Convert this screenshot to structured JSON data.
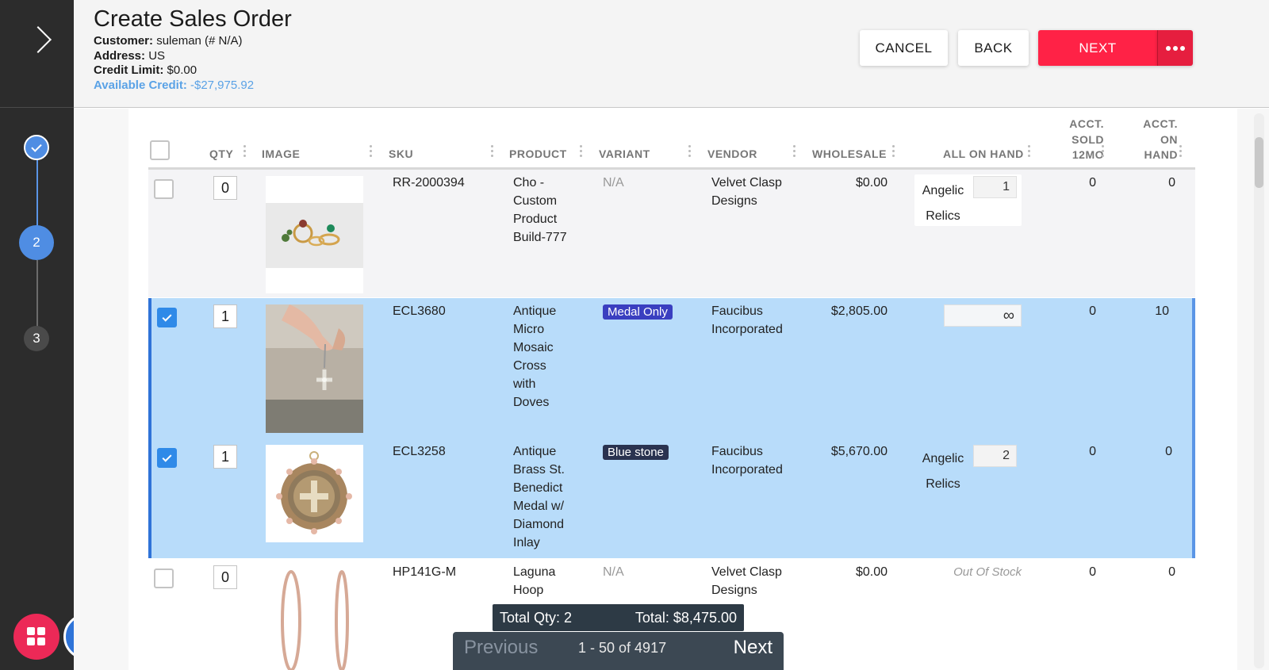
{
  "header": {
    "title": "Create Sales Order",
    "customer_label": "Customer:",
    "customer_value": "suleman (# N/A)",
    "address_label": "Address:",
    "address_value": "US",
    "credit_limit_label": "Credit Limit:",
    "credit_limit_value": "$0.00",
    "available_credit_label": "Available Credit:",
    "available_credit_value": "-$27,975.92",
    "cancel_label": "CANCEL",
    "back_label": "BACK",
    "next_label": "NEXT"
  },
  "steps": {
    "step2": "2",
    "step3": "3"
  },
  "table": {
    "columns": {
      "qty": "QTY",
      "image": "IMAGE",
      "sku": "SKU",
      "product": "PRODUCT",
      "variant": "VARIANT",
      "vendor": "VENDOR",
      "wholesale": "WHOLESALE",
      "all_on_hand": "ALL ON HAND",
      "acct_sold_1": "ACCT.",
      "acct_sold_2": "SOLD",
      "acct_sold_3": "12MO",
      "acct_on_1": "ACCT.",
      "acct_on_2": "ON",
      "acct_on_3": "HAND"
    },
    "rows": [
      {
        "qty": "0",
        "sku": "RR-2000394",
        "product": [
          "Cho -",
          "Custom",
          "Product",
          "Build-777"
        ],
        "variant": "N/A",
        "vendor": [
          "Velvet Clasp",
          "Designs"
        ],
        "wholesale": "$0.00",
        "onhand_loc": [
          "Angelic",
          "Relics"
        ],
        "onhand_qty": "1",
        "acct_sold": "0",
        "acct_on_hand": "0"
      },
      {
        "qty": "1",
        "sku": "ECL3680",
        "product": [
          "Antique",
          "Micro",
          "Mosaic",
          "Cross",
          "with",
          "Doves"
        ],
        "variant": "Medal Only",
        "vendor": [
          "Faucibus",
          "Incorporated"
        ],
        "wholesale": "$2,805.00",
        "onhand_qty": "∞",
        "acct_sold": "0",
        "acct_on_hand": "10"
      },
      {
        "qty": "1",
        "sku": "ECL3258",
        "product": [
          "Antique",
          "Brass St.",
          "Benedict",
          "Medal w/",
          "Diamond",
          "Inlay"
        ],
        "variant": "Blue stone",
        "vendor": [
          "Faucibus",
          "Incorporated"
        ],
        "wholesale": "$5,670.00",
        "onhand_loc": [
          "Angelic",
          "Relics"
        ],
        "onhand_qty": "2",
        "acct_sold": "0",
        "acct_on_hand": "0"
      },
      {
        "qty": "0",
        "sku": "HP141G-M",
        "product": [
          "Laguna",
          "Hoop"
        ],
        "variant": "N/A",
        "vendor": [
          "Velvet Clasp",
          "Designs"
        ],
        "wholesale": "$0.00",
        "onhand_status": "Out Of Stock",
        "acct_sold": "0",
        "acct_on_hand": "0"
      }
    ]
  },
  "summary": {
    "total_qty": "Total Qty: 2",
    "total": "Total: $8,475.00"
  },
  "pager": {
    "previous": "Previous",
    "range": "1 - 50 of 4917",
    "next": "Next"
  },
  "colors": {
    "accent": "#ff2246",
    "selected_row": "#b8dcfa",
    "step_active": "#4f8de3",
    "credit": "#5aa2e6",
    "badge_medal": "#3a3fc0",
    "badge_blue": "#2a3350"
  }
}
